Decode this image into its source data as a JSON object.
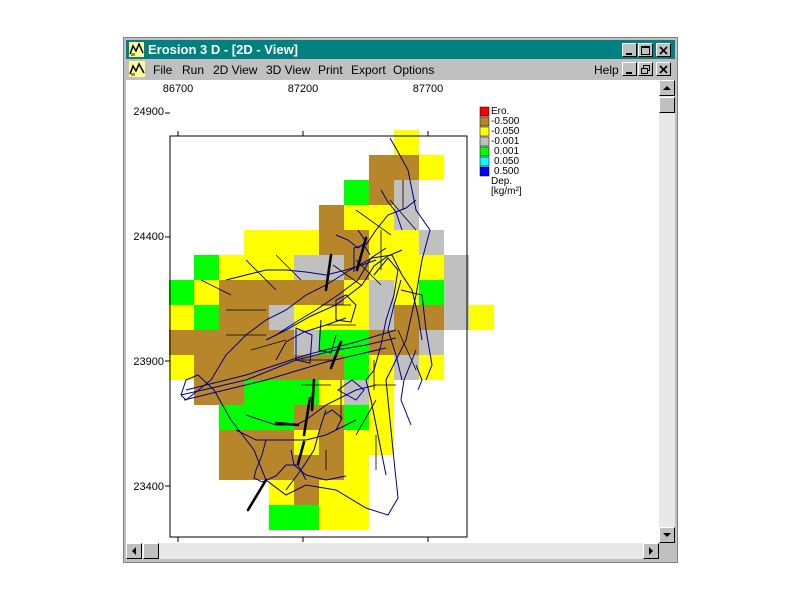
{
  "window": {
    "title": "Erosion 3 D - [2D - View]",
    "titlebar_color": "#008080"
  },
  "menu": {
    "items": [
      "File",
      "Run",
      "2D View",
      "3D View",
      "Print",
      "Export",
      "Options"
    ],
    "help": "Help"
  },
  "map": {
    "x_ticks": [
      "86700",
      "87200",
      "87700"
    ],
    "y_ticks": [
      "24900",
      "24400",
      "23900",
      "23400"
    ]
  },
  "legend": {
    "title": "Ero.",
    "entries": [
      {
        "label": "-0.500",
        "color": "#ff0000"
      },
      {
        "label": "-0.050",
        "color": "#b8862a"
      },
      {
        "label": "-0.001",
        "color": "#ffff00"
      },
      {
        "label": "",
        "color": "#c0c0c0"
      },
      {
        "label": "0.001",
        "color": "#00ff00"
      },
      {
        "label": "0.050",
        "color": "#00ffff"
      },
      {
        "label": "0.500",
        "color": "#0000ff"
      }
    ],
    "footer1": "Dep.",
    "footer2": "[kg/m²]"
  },
  "grid_rows": [
    {
      "row": 0,
      "col": 9,
      "cells": "Y"
    },
    {
      "row": 1,
      "col": 8,
      "cells": "BBY"
    },
    {
      "row": 2,
      "col": 7,
      "cells": "GBB"
    },
    {
      "row": 3,
      "col": 6,
      "cells": "BYYY"
    },
    {
      "row": 4,
      "col": 3,
      "cells": "YYYBBYYG"
    },
    {
      "row": 5,
      "col": 1,
      "cells": "GYYYYBBYYYY"
    },
    {
      "row": 6,
      "col": 0,
      "cells": "GYBBBBBYGYGY"
    },
    {
      "row": 7,
      "col": 0,
      "cells": "YGBBBYYYGBBGY"
    },
    {
      "row": 8,
      "col": 0,
      "cells": "BBBBBBGGBBB"
    },
    {
      "row": 9,
      "col": 0,
      "cells": "YBBBBBBGYBY"
    },
    {
      "row": 10,
      "col": 1,
      "cells": "BBGGGYBY"
    },
    {
      "row": 11,
      "col": 2,
      "cells": "GGGBBGY"
    },
    {
      "row": 12,
      "col": 2,
      "cells": "BBBYBYY"
    },
    {
      "row": 13,
      "col": 2,
      "cells": "BBBBBY"
    },
    {
      "row": 14,
      "col": 4,
      "cells": "YBYY"
    },
    {
      "row": 15,
      "col": 4,
      "cells": "GGYY"
    }
  ]
}
